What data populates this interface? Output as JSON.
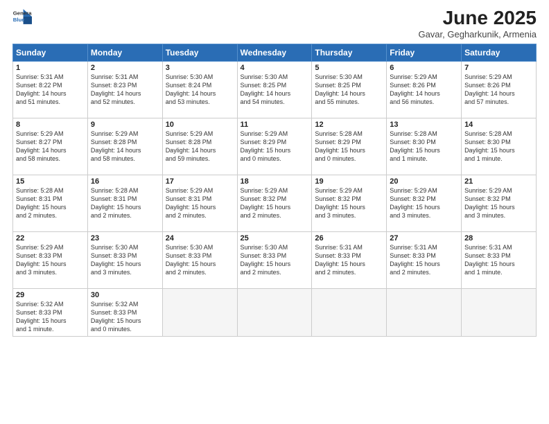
{
  "logo": {
    "line1": "General",
    "line2": "Blue"
  },
  "title": "June 2025",
  "subtitle": "Gavar, Gegharkunik, Armenia",
  "days_of_week": [
    "Sunday",
    "Monday",
    "Tuesday",
    "Wednesday",
    "Thursday",
    "Friday",
    "Saturday"
  ],
  "weeks": [
    [
      {
        "day": "1",
        "info": "Sunrise: 5:31 AM\nSunset: 8:22 PM\nDaylight: 14 hours\nand 51 minutes."
      },
      {
        "day": "2",
        "info": "Sunrise: 5:31 AM\nSunset: 8:23 PM\nDaylight: 14 hours\nand 52 minutes."
      },
      {
        "day": "3",
        "info": "Sunrise: 5:30 AM\nSunset: 8:24 PM\nDaylight: 14 hours\nand 53 minutes."
      },
      {
        "day": "4",
        "info": "Sunrise: 5:30 AM\nSunset: 8:25 PM\nDaylight: 14 hours\nand 54 minutes."
      },
      {
        "day": "5",
        "info": "Sunrise: 5:30 AM\nSunset: 8:25 PM\nDaylight: 14 hours\nand 55 minutes."
      },
      {
        "day": "6",
        "info": "Sunrise: 5:29 AM\nSunset: 8:26 PM\nDaylight: 14 hours\nand 56 minutes."
      },
      {
        "day": "7",
        "info": "Sunrise: 5:29 AM\nSunset: 8:26 PM\nDaylight: 14 hours\nand 57 minutes."
      }
    ],
    [
      {
        "day": "8",
        "info": "Sunrise: 5:29 AM\nSunset: 8:27 PM\nDaylight: 14 hours\nand 58 minutes."
      },
      {
        "day": "9",
        "info": "Sunrise: 5:29 AM\nSunset: 8:28 PM\nDaylight: 14 hours\nand 58 minutes."
      },
      {
        "day": "10",
        "info": "Sunrise: 5:29 AM\nSunset: 8:28 PM\nDaylight: 14 hours\nand 59 minutes."
      },
      {
        "day": "11",
        "info": "Sunrise: 5:29 AM\nSunset: 8:29 PM\nDaylight: 15 hours\nand 0 minutes."
      },
      {
        "day": "12",
        "info": "Sunrise: 5:28 AM\nSunset: 8:29 PM\nDaylight: 15 hours\nand 0 minutes."
      },
      {
        "day": "13",
        "info": "Sunrise: 5:28 AM\nSunset: 8:30 PM\nDaylight: 15 hours\nand 1 minute."
      },
      {
        "day": "14",
        "info": "Sunrise: 5:28 AM\nSunset: 8:30 PM\nDaylight: 15 hours\nand 1 minute."
      }
    ],
    [
      {
        "day": "15",
        "info": "Sunrise: 5:28 AM\nSunset: 8:31 PM\nDaylight: 15 hours\nand 2 minutes."
      },
      {
        "day": "16",
        "info": "Sunrise: 5:28 AM\nSunset: 8:31 PM\nDaylight: 15 hours\nand 2 minutes."
      },
      {
        "day": "17",
        "info": "Sunrise: 5:29 AM\nSunset: 8:31 PM\nDaylight: 15 hours\nand 2 minutes."
      },
      {
        "day": "18",
        "info": "Sunrise: 5:29 AM\nSunset: 8:32 PM\nDaylight: 15 hours\nand 2 minutes."
      },
      {
        "day": "19",
        "info": "Sunrise: 5:29 AM\nSunset: 8:32 PM\nDaylight: 15 hours\nand 3 minutes."
      },
      {
        "day": "20",
        "info": "Sunrise: 5:29 AM\nSunset: 8:32 PM\nDaylight: 15 hours\nand 3 minutes."
      },
      {
        "day": "21",
        "info": "Sunrise: 5:29 AM\nSunset: 8:32 PM\nDaylight: 15 hours\nand 3 minutes."
      }
    ],
    [
      {
        "day": "22",
        "info": "Sunrise: 5:29 AM\nSunset: 8:33 PM\nDaylight: 15 hours\nand 3 minutes."
      },
      {
        "day": "23",
        "info": "Sunrise: 5:30 AM\nSunset: 8:33 PM\nDaylight: 15 hours\nand 3 minutes."
      },
      {
        "day": "24",
        "info": "Sunrise: 5:30 AM\nSunset: 8:33 PM\nDaylight: 15 hours\nand 2 minutes."
      },
      {
        "day": "25",
        "info": "Sunrise: 5:30 AM\nSunset: 8:33 PM\nDaylight: 15 hours\nand 2 minutes."
      },
      {
        "day": "26",
        "info": "Sunrise: 5:31 AM\nSunset: 8:33 PM\nDaylight: 15 hours\nand 2 minutes."
      },
      {
        "day": "27",
        "info": "Sunrise: 5:31 AM\nSunset: 8:33 PM\nDaylight: 15 hours\nand 2 minutes."
      },
      {
        "day": "28",
        "info": "Sunrise: 5:31 AM\nSunset: 8:33 PM\nDaylight: 15 hours\nand 1 minute."
      }
    ],
    [
      {
        "day": "29",
        "info": "Sunrise: 5:32 AM\nSunset: 8:33 PM\nDaylight: 15 hours\nand 1 minute."
      },
      {
        "day": "30",
        "info": "Sunrise: 5:32 AM\nSunset: 8:33 PM\nDaylight: 15 hours\nand 0 minutes."
      },
      null,
      null,
      null,
      null,
      null
    ]
  ]
}
